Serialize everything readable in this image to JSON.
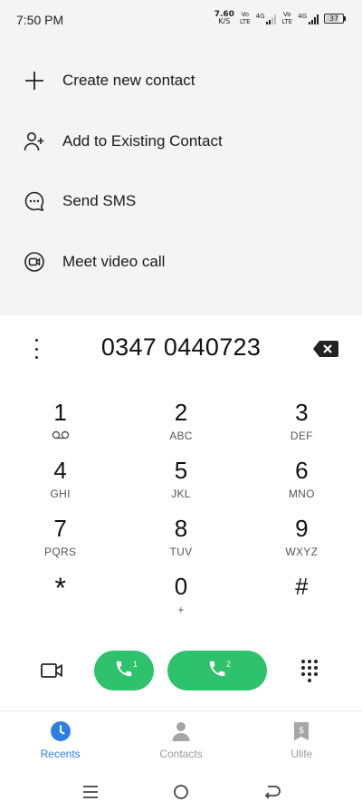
{
  "status_bar": {
    "time": "7:50 PM",
    "net_speed_value": "7.60",
    "net_speed_unit": "K/S",
    "sim1_volte": [
      "Vo",
      "LTE"
    ],
    "sim1_network": "4G",
    "sim2_volte": [
      "Vo",
      "LTE"
    ],
    "sim2_network": "4G",
    "battery_level": "37"
  },
  "menu": {
    "items": [
      {
        "label": "Create new contact",
        "icon": "plus-icon"
      },
      {
        "label": "Add to Existing Contact",
        "icon": "add-person-icon"
      },
      {
        "label": "Send SMS",
        "icon": "chat-bubble-icon"
      },
      {
        "label": "Meet video call",
        "icon": "video-meet-icon"
      }
    ]
  },
  "dialer": {
    "number": "0347 0440723"
  },
  "keypad": {
    "keys": [
      {
        "digit": "1",
        "sub": ""
      },
      {
        "digit": "2",
        "sub": "ABC"
      },
      {
        "digit": "3",
        "sub": "DEF"
      },
      {
        "digit": "4",
        "sub": "GHI"
      },
      {
        "digit": "5",
        "sub": "JKL"
      },
      {
        "digit": "6",
        "sub": "MNO"
      },
      {
        "digit": "7",
        "sub": "PQRS"
      },
      {
        "digit": "8",
        "sub": "TUV"
      },
      {
        "digit": "9",
        "sub": "WXYZ"
      },
      {
        "digit": "*",
        "sub": ""
      },
      {
        "digit": "0",
        "sub": "+"
      },
      {
        "digit": "#",
        "sub": ""
      }
    ]
  },
  "actions": {
    "call_sim1_label": "1",
    "call_sim2_label": "2",
    "call_color": "#2dc26b"
  },
  "tabs": [
    {
      "label": "Recents",
      "icon": "clock-icon",
      "active": true
    },
    {
      "label": "Contacts",
      "icon": "person-icon",
      "active": false
    },
    {
      "label": "Ulife",
      "icon": "ulife-icon",
      "active": false
    }
  ],
  "colors": {
    "accent": "#2f7fe3",
    "top_background": "#f4f4f4"
  }
}
